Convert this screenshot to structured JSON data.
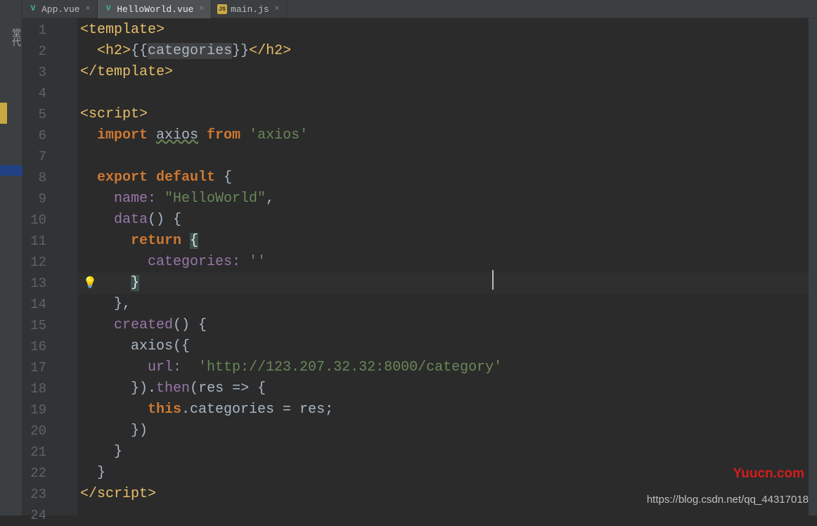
{
  "sidebar": {
    "label": "堂代"
  },
  "tabs": [
    {
      "label": "App.vue",
      "icon": "V",
      "type": "vue",
      "active": false
    },
    {
      "label": "HelloWorld.vue",
      "icon": "V",
      "type": "vue",
      "active": true
    },
    {
      "label": "main.js",
      "icon": "JS",
      "type": "js",
      "active": false
    }
  ],
  "lines": [
    "1",
    "2",
    "3",
    "4",
    "5",
    "6",
    "7",
    "8",
    "9",
    "10",
    "11",
    "12",
    "13",
    "14",
    "15",
    "16",
    "17",
    "18",
    "19",
    "20",
    "21",
    "22",
    "23",
    "24"
  ],
  "code": {
    "l1_open": "<template>",
    "l2_a": "<h2>",
    "l2_b": "{{",
    "l2_c": "categories",
    "l2_d": "}}",
    "l2_e": "</h2>",
    "l3": "</template>",
    "l5": "<script>",
    "l6_a": "import ",
    "l6_b": "axios",
    "l6_c": " from ",
    "l6_d": "'axios'",
    "l8_a": "export ",
    "l8_b": "default ",
    "l8_c": "{",
    "l9_a": "name: ",
    "l9_b": "\"HelloWorld\"",
    "l9_c": ",",
    "l10_a": "data",
    "l10_b": "() {",
    "l11_a": "return ",
    "l11_b": "{",
    "l12_a": "categories: ",
    "l12_b": "''",
    "l13": "}",
    "l14": "},",
    "l15_a": "created",
    "l15_b": "() {",
    "l16_a": "axios",
    "l16_b": "({",
    "l17_a": "url:  ",
    "l17_b": "'http://123.207.32.32:8000/category'",
    "l18_a": "}).",
    "l18_b": "then",
    "l18_c": "(",
    "l18_d": "res ",
    "l18_e": "=> {",
    "l19_a": "this",
    "l19_b": ".categories = res;",
    "l20": "})",
    "l21": "}",
    "l22": "}",
    "l23": "</script>"
  },
  "watermark": {
    "red": "Yuucn.com",
    "gray": "https://blog.csdn.net/qq_44317018"
  }
}
